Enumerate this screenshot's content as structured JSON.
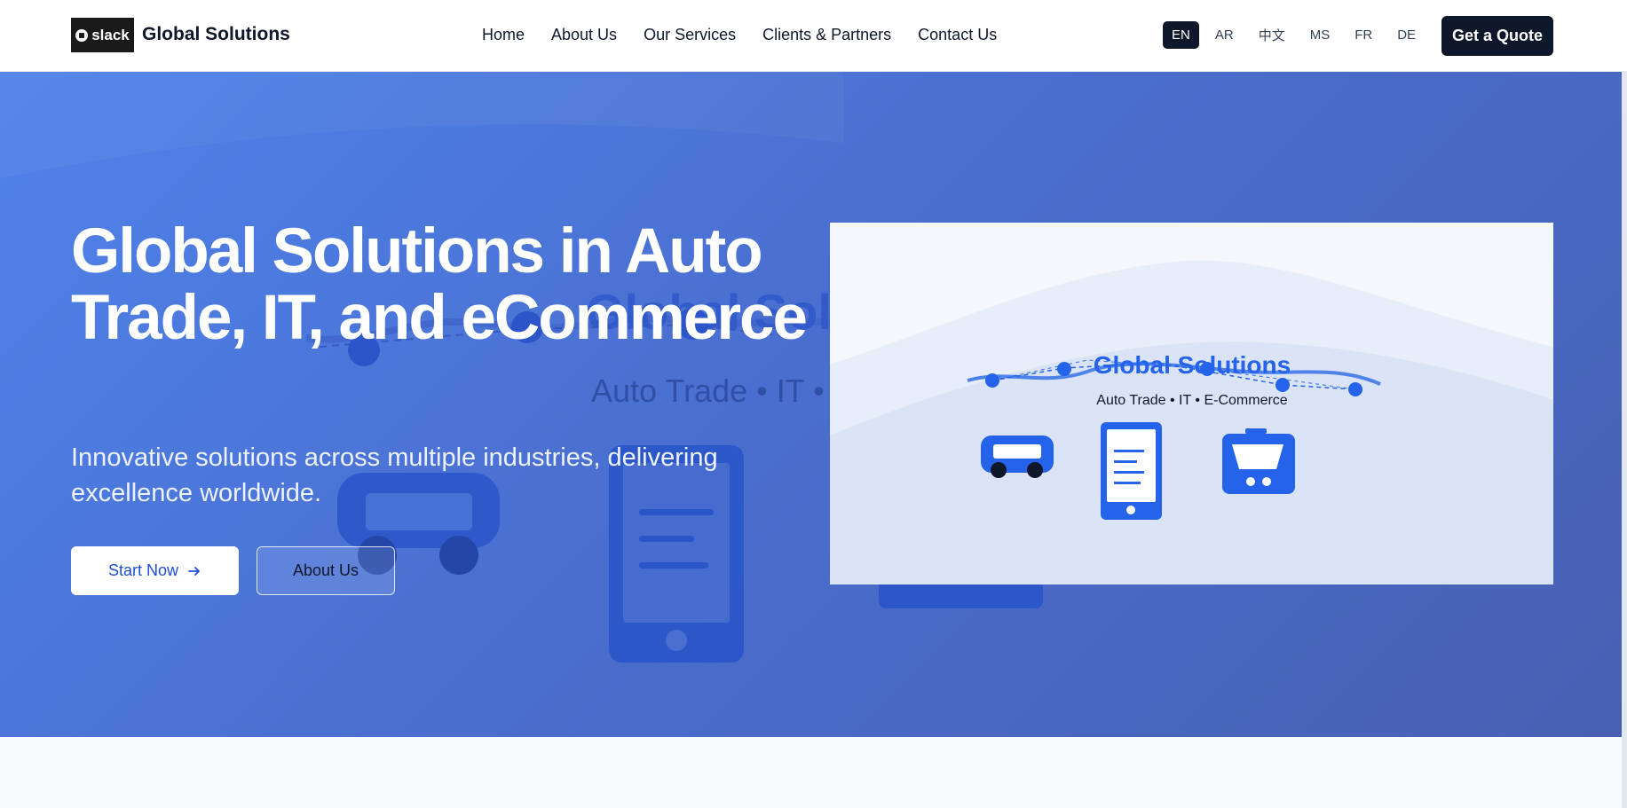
{
  "header": {
    "logo_text": "slack",
    "brand": "Global Solutions",
    "nav": [
      "Home",
      "About Us",
      "Our Services",
      "Clients & Partners",
      "Contact Us"
    ],
    "languages": [
      "EN",
      "AR",
      "中文",
      "MS",
      "FR",
      "DE"
    ],
    "active_language": "EN",
    "cta": "Get a Quote"
  },
  "hero": {
    "title": "Global Solutions in Auto Trade, IT, and eCommerce",
    "subtitle": "Innovative solutions across multiple industries, delivering excellence worldwide.",
    "primary_button": "Start Now",
    "secondary_button": "About Us",
    "bg_title": "Global Solutions",
    "bg_subtitle": "Auto Trade • IT • E-Commerce"
  },
  "card": {
    "title": "Global Solutions",
    "subtitle": "Auto Trade • IT • E-Commerce"
  },
  "colors": {
    "primary": "#2563eb",
    "dark": "#0f172a",
    "hero_start": "#4f83ea",
    "hero_end": "#4760b3"
  }
}
